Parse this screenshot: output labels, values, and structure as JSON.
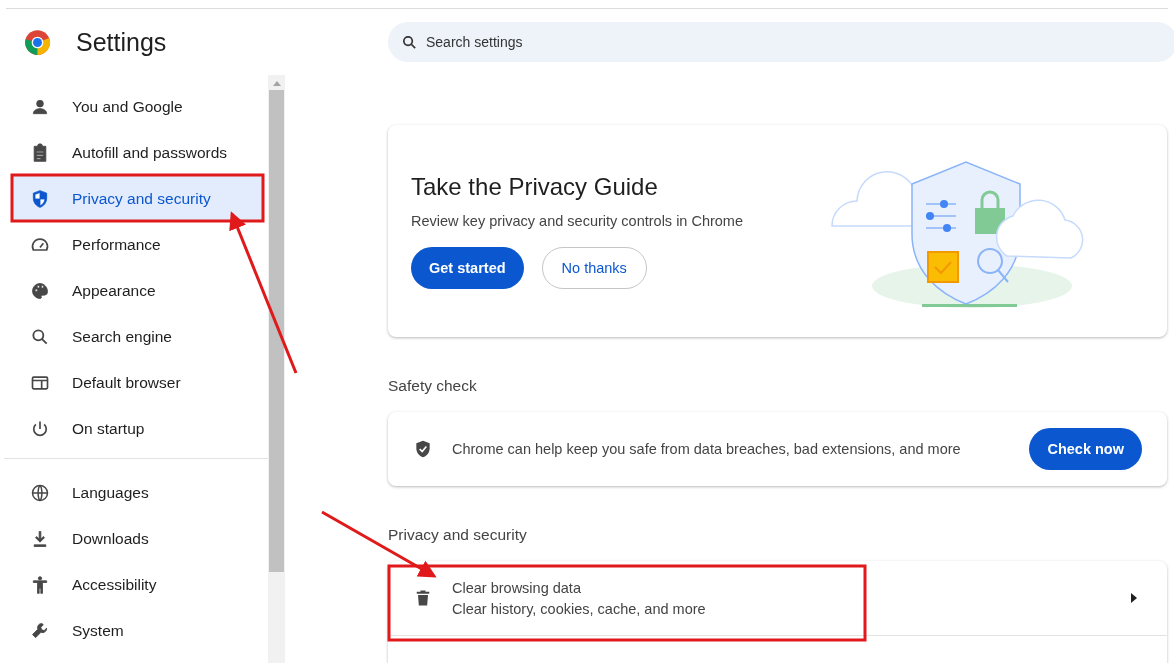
{
  "header": {
    "title": "Settings"
  },
  "search": {
    "placeholder": "Search settings"
  },
  "sidebar": {
    "groups": [
      {
        "items": [
          {
            "label": "You and Google",
            "kind": "person",
            "selected": false
          },
          {
            "label": "Autofill and passwords",
            "kind": "clipboard",
            "selected": false
          },
          {
            "label": "Privacy and security",
            "kind": "shield",
            "selected": true
          },
          {
            "label": "Performance",
            "kind": "gauge",
            "selected": false
          },
          {
            "label": "Appearance",
            "kind": "palette",
            "selected": false
          },
          {
            "label": "Search engine",
            "kind": "search",
            "selected": false
          },
          {
            "label": "Default browser",
            "kind": "browser",
            "selected": false
          },
          {
            "label": "On startup",
            "kind": "power",
            "selected": false
          }
        ]
      },
      {
        "items": [
          {
            "label": "Languages",
            "kind": "globe",
            "selected": false
          },
          {
            "label": "Downloads",
            "kind": "download",
            "selected": false
          },
          {
            "label": "Accessibility",
            "kind": "accessibility",
            "selected": false
          },
          {
            "label": "System",
            "kind": "wrench",
            "selected": false
          }
        ]
      }
    ]
  },
  "privacy_guide": {
    "title": "Take the Privacy Guide",
    "description": "Review key privacy and security controls in Chrome",
    "primary_button": "Get started",
    "secondary_button": "No thanks"
  },
  "safety_check": {
    "heading": "Safety check",
    "text": "Chrome can help keep you safe from data breaches, bad extensions, and more",
    "button": "Check now"
  },
  "privacy_section": {
    "heading": "Privacy and security",
    "rows": [
      {
        "title": "Clear browsing data",
        "subtitle": "Clear history, cookies, cache, and more",
        "kind": "trash"
      }
    ]
  }
}
